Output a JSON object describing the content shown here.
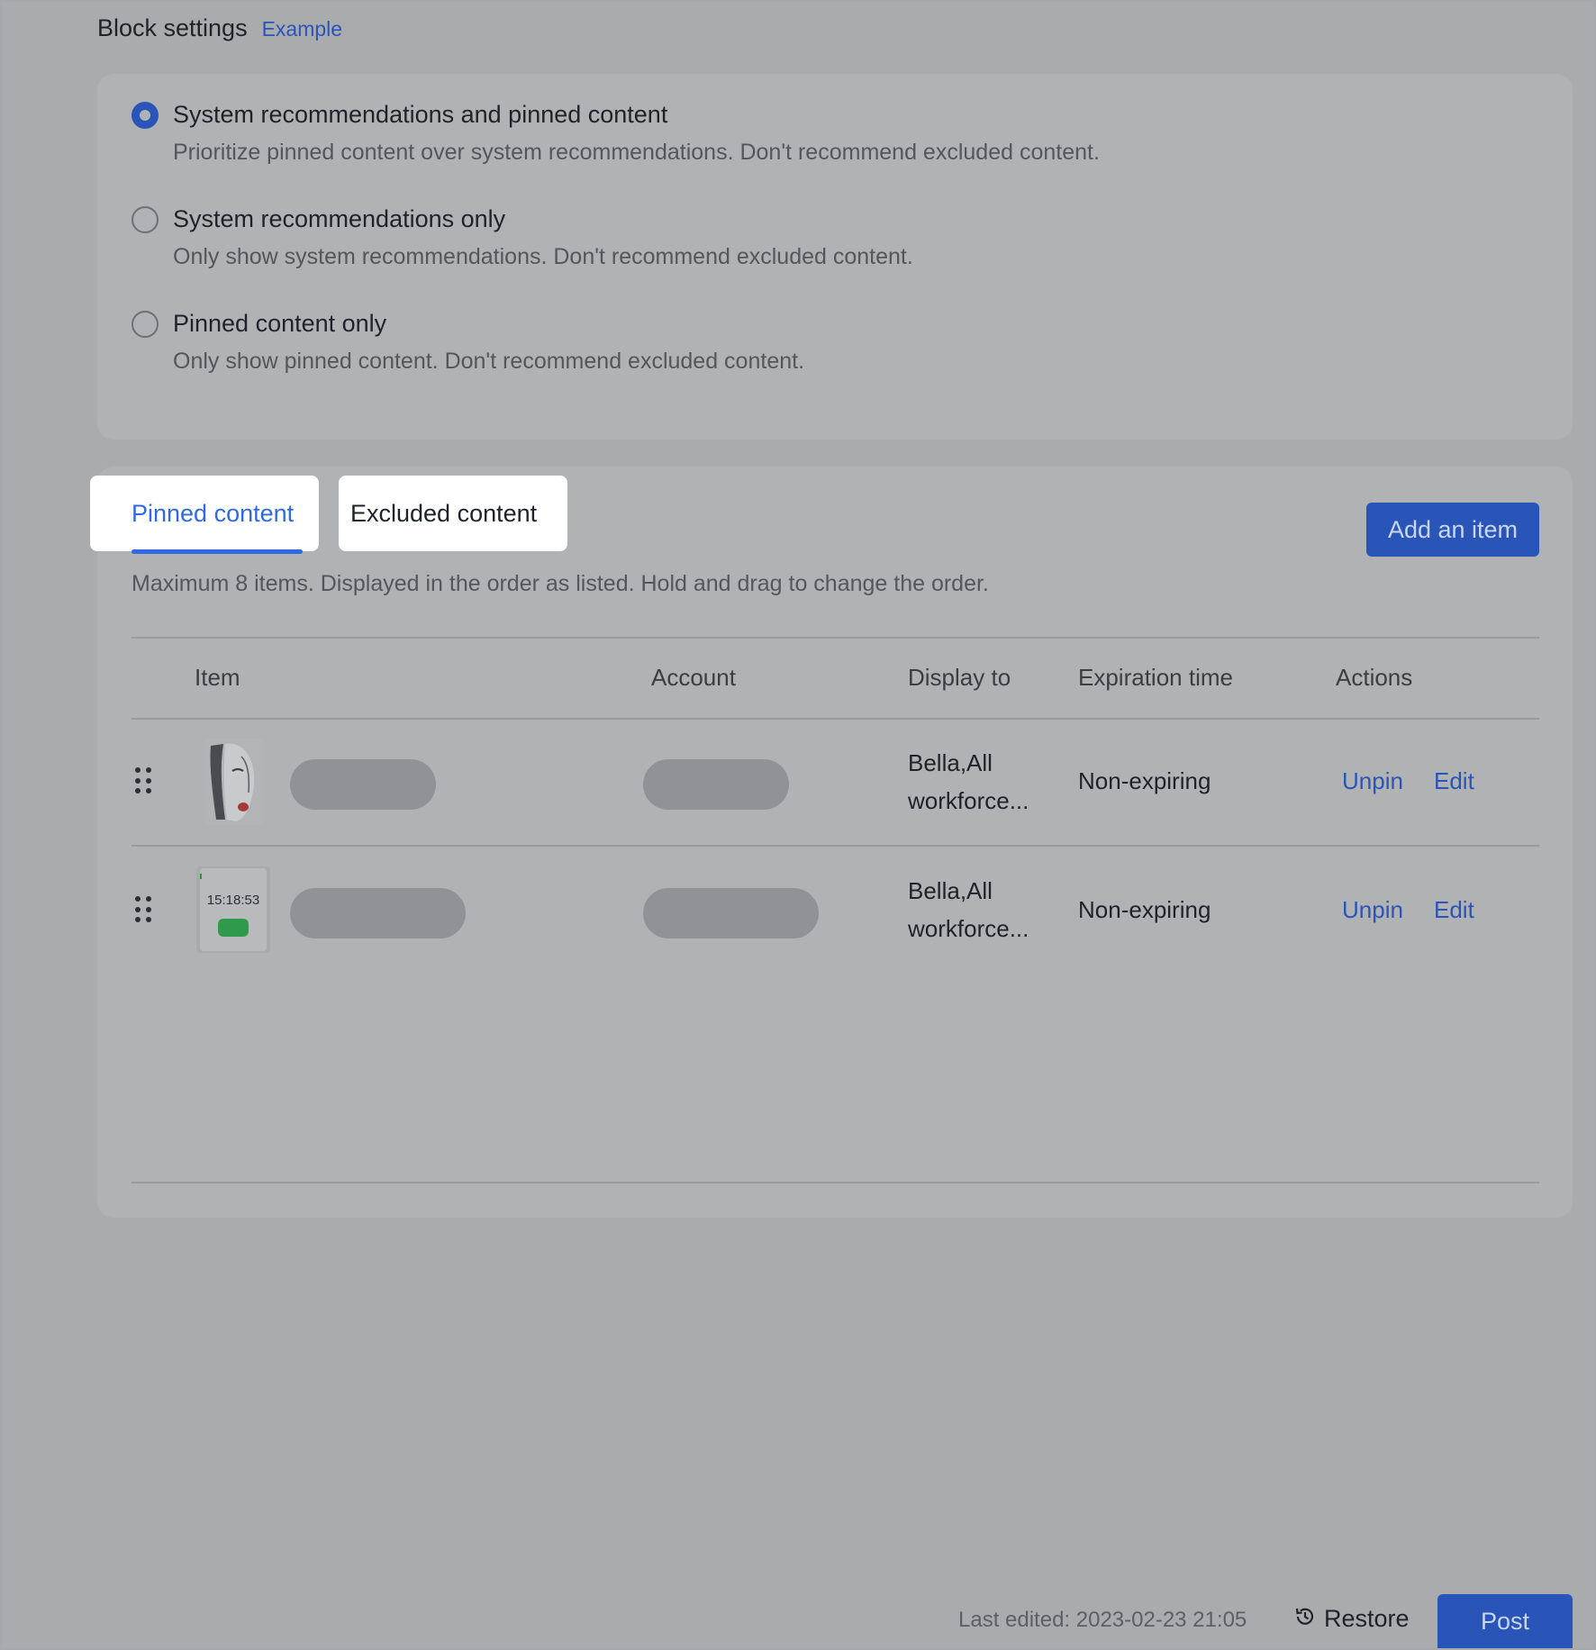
{
  "header": {
    "title": "Block settings",
    "example_link": "Example"
  },
  "modes": {
    "selected_index": 0,
    "options": [
      {
        "label": "System recommendations and pinned content",
        "description": "Prioritize pinned content over system recommendations. Don't recommend excluded content."
      },
      {
        "label": "System recommendations only",
        "description": "Only show system recommendations. Don't recommend excluded content."
      },
      {
        "label": "Pinned content only",
        "description": "Only show pinned content. Don't recommend excluded content."
      }
    ]
  },
  "tabs": {
    "pinned": "Pinned content",
    "excluded": "Excluded content",
    "active": "pinned"
  },
  "add_button": "Add an item",
  "hint": "Maximum 8 items. Displayed in the order as listed. Hold and drag to change the order.",
  "table": {
    "columns": {
      "item": "Item",
      "account": "Account",
      "display_to": "Display to",
      "expiration": "Expiration time",
      "actions": "Actions"
    },
    "rows": [
      {
        "display_to_line1": "Bella,All",
        "display_to_line2": "workforce...",
        "expiration": "Non-expiring",
        "unpin": "Unpin",
        "edit": "Edit",
        "thumbnail": "portrait-sketch-image"
      },
      {
        "display_to_line1": "Bella,All",
        "display_to_line2": "workforce...",
        "expiration": "Non-expiring",
        "unpin": "Unpin",
        "edit": "Edit",
        "thumbnail": "phone-clock-screenshot",
        "thumbnail_clock_text": "15:18:53"
      }
    ]
  },
  "footer": {
    "last_edited_label": "Last edited:",
    "last_edited_value": "2023-02-23 21:05",
    "restore": "Restore",
    "post": "Post"
  },
  "colors": {
    "accent": "#2a55b8",
    "tab_active": "#2f6ae4",
    "overlay_bg": "#aaabad"
  }
}
